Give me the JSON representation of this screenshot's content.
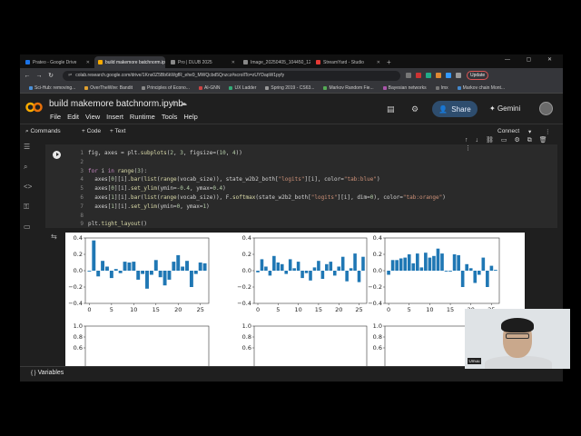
{
  "browser": {
    "tabs": [
      {
        "label": "Prateo - Google Drive",
        "color": "#1a73e8",
        "active": false
      },
      {
        "label": "build makemore batchnorm.ipynb",
        "color": "#f9ab00",
        "active": true
      },
      {
        "label": "Pro | DLUB 2025",
        "color": "#888888",
        "active": false
      },
      {
        "label": "Image_20250405_104450_126.jpg",
        "color": "#888888",
        "active": false
      },
      {
        "label": "StreamYard - Studio",
        "color": "#e53935",
        "active": false
      }
    ],
    "url": "colab.research.google.com/drive/1Kns0Z5Bb6kWgfR_ehe9_MWQcbd5Qnzcz#scrollTo=zUYDapW1pyfy",
    "update_label": "Update",
    "bookmarks": [
      "Sci-Hub: removing...",
      "OverTheWire: Bandit",
      "Principles of Econo...",
      "AI-GNN",
      "UX Ladder",
      "Spring 2019 - CS63...",
      "Markov Random Fie...",
      "Bayesian networks",
      "Imx",
      "Markov chain Mont..."
    ]
  },
  "colab": {
    "notebook_title": "build makemore batchnorm.ipynb",
    "menu": [
      "File",
      "Edit",
      "View",
      "Insert",
      "Runtime",
      "Tools",
      "Help"
    ],
    "share_label": "Share",
    "gemini_label": "Gemini",
    "toolbar": {
      "commands": "Commands",
      "add_code": "+ Code",
      "add_text": "+ Text",
      "connect": "Connect"
    },
    "code_lines": [
      {
        "n": "1",
        "text": "fig, axes = plt.subplots(2, 3, figsize=(10, 4))"
      },
      {
        "n": "2",
        "text": ""
      },
      {
        "n": "3",
        "text": "for i in range(3):"
      },
      {
        "n": "4",
        "text": "  axes[0][i].bar(list(range(vocab_size)), state_w2b2_both[\"logits\"][i], color=\"tab:blue\")"
      },
      {
        "n": "5",
        "text": "  axes[0][i].set_ylim(ymin=-0.4, ymax=0.4)"
      },
      {
        "n": "6",
        "text": "  axes[1][i].bar(list(range(vocab_size)), F.softmax(state_w2b2_both[\"logits\"][i], dim=0), color=\"tab:orange\")"
      },
      {
        "n": "7",
        "text": "  axes[1][i].set_ylim(ymin=0, ymax=1)"
      },
      {
        "n": "8",
        "text": ""
      },
      {
        "n": "9",
        "text": "plt.tight_layout()"
      }
    ],
    "variables_label": "Variables"
  },
  "chart_data": [
    {
      "type": "bar",
      "ylim": [
        -0.4,
        0.4
      ],
      "yticks": [
        "0.4",
        "0.2",
        "0.0",
        "−0.2",
        "−0.4"
      ],
      "xticks": [
        "0",
        "5",
        "10",
        "15",
        "20",
        "25"
      ],
      "color": "#1f77b4",
      "x": [
        0,
        1,
        2,
        3,
        4,
        5,
        6,
        7,
        8,
        9,
        10,
        11,
        12,
        13,
        14,
        15,
        16,
        17,
        18,
        19,
        20,
        21,
        22,
        23,
        24,
        25,
        26
      ],
      "values": [
        -0.01,
        0.37,
        -0.07,
        0.12,
        0.05,
        -0.09,
        0.02,
        -0.03,
        0.11,
        0.1,
        0.11,
        -0.11,
        -0.04,
        -0.22,
        -0.05,
        0.13,
        -0.08,
        -0.18,
        -0.11,
        0.11,
        0.19,
        0.05,
        0.12,
        -0.2,
        -0.04,
        0.1,
        0.09
      ]
    },
    {
      "type": "bar",
      "ylim": [
        -0.4,
        0.4
      ],
      "yticks": [
        "0.4",
        "0.2",
        "0.0",
        "−0.2",
        "−0.4"
      ],
      "xticks": [
        "0",
        "5",
        "10",
        "15",
        "20",
        "25"
      ],
      "color": "#1f77b4",
      "x": [
        0,
        1,
        2,
        3,
        4,
        5,
        6,
        7,
        8,
        9,
        10,
        11,
        12,
        13,
        14,
        15,
        16,
        17,
        18,
        19,
        20,
        21,
        22,
        23,
        24,
        25,
        26
      ],
      "values": [
        -0.02,
        0.14,
        0.05,
        -0.06,
        0.18,
        0.1,
        0.08,
        -0.04,
        0.14,
        0.03,
        0.11,
        -0.09,
        -0.03,
        -0.12,
        0.04,
        0.12,
        -0.1,
        0.08,
        0.11,
        -0.06,
        0.05,
        0.17,
        -0.13,
        0.03,
        0.21,
        -0.14,
        0.17
      ]
    },
    {
      "type": "bar",
      "ylim": [
        -0.4,
        0.4
      ],
      "yticks": [
        "0.4",
        "0.2",
        "0.0",
        "−0.2",
        "−0.4"
      ],
      "xticks": [
        "0",
        "5",
        "10",
        "15",
        "20",
        "25"
      ],
      "color": "#1f77b4",
      "x": [
        0,
        1,
        2,
        3,
        4,
        5,
        6,
        7,
        8,
        9,
        10,
        11,
        12,
        13,
        14,
        15,
        16,
        17,
        18,
        19,
        20,
        21,
        22,
        23,
        24,
        25,
        26
      ],
      "values": [
        -0.05,
        0.13,
        0.13,
        0.15,
        0.16,
        0.2,
        0.09,
        0.21,
        0.04,
        0.22,
        0.16,
        0.18,
        0.27,
        0.21,
        -0.01,
        -0.01,
        0.2,
        0.19,
        -0.2,
        0.08,
        0.03,
        -0.15,
        -0.05,
        0.16,
        -0.2,
        0.06,
        0.01
      ]
    },
    {
      "type": "bar",
      "ylim": [
        0,
        1
      ],
      "yticks": [
        "1.0",
        "0.8",
        "0.6"
      ],
      "xticks": [],
      "color": "#ff7f0e",
      "x": [],
      "values": []
    },
    {
      "type": "bar",
      "ylim": [
        0,
        1
      ],
      "yticks": [
        "1.0",
        "0.8",
        "0.6"
      ],
      "xticks": [],
      "color": "#ff7f0e",
      "x": [],
      "values": []
    },
    {
      "type": "bar",
      "ylim": [
        0,
        1
      ],
      "yticks": [
        "1.0",
        "0.8",
        "0.6"
      ],
      "xticks": [],
      "color": "#ff7f0e",
      "x": [],
      "values": []
    }
  ],
  "webcam": {
    "label": "Umuu"
  }
}
